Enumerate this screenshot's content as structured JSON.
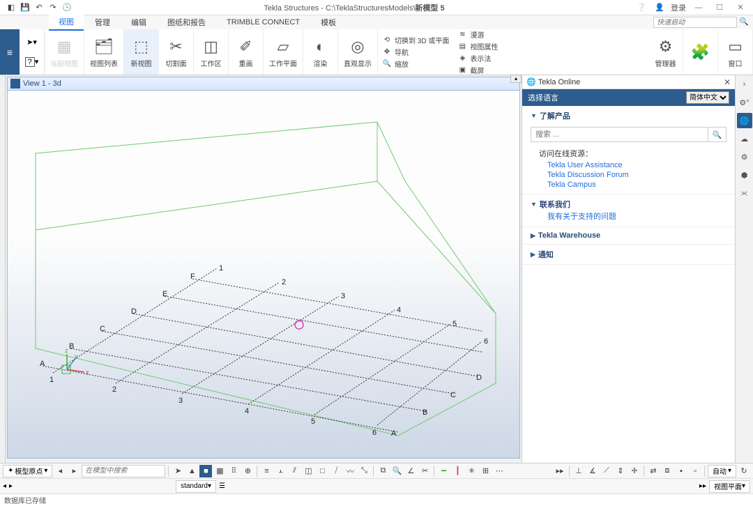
{
  "title": {
    "app": "Tekla Structures",
    "path": "C:\\TeklaStructuresModels\\",
    "model": "新模型 5"
  },
  "titlebar": {
    "login": "登录"
  },
  "menubar": {
    "tabs": [
      "视图",
      "管理",
      "编辑",
      "图纸和报告",
      "TRIMBLE CONNECT",
      "模板"
    ],
    "active": 0,
    "quick_placeholder": "快速启动"
  },
  "ribbon": {
    "groups": [
      {
        "label": "当前视图",
        "disabled": true
      },
      {
        "label": "视图列表"
      },
      {
        "label": "新视图",
        "active": true
      },
      {
        "label": "切割面"
      },
      {
        "label": "工作区"
      },
      {
        "label": "重画"
      },
      {
        "label": "工作平面"
      },
      {
        "label": "渲染"
      },
      {
        "label": "直观显示"
      }
    ],
    "sub3d": {
      "a": "切换到 3D 或平面",
      "b": "导航",
      "c": "缩放"
    },
    "subview": {
      "a": "漫游",
      "b": "视图属性",
      "c": "表示法",
      "d": "截屏"
    },
    "right": [
      {
        "label": "管理器"
      },
      {
        "label": ""
      },
      {
        "label": "窗口"
      }
    ]
  },
  "view": {
    "header": "View 1 - 3d",
    "labels_near": {
      "A": "A",
      "B": "B",
      "C": "C",
      "D": "D",
      "E": "E",
      "F": "F",
      "1": "1",
      "2": "2",
      "3": "3",
      "4": "4",
      "5": "5",
      "6": "6"
    },
    "axes": {
      "x": "x",
      "y": "y",
      "z": "z"
    }
  },
  "online": {
    "title": "Tekla Online",
    "langlabel": "选择语言",
    "lang": "简体中文",
    "sections": {
      "learn": {
        "title": "了解产品",
        "search_ph": "搜索 ...",
        "resources_label": "访问在线资源：",
        "links": [
          "Tekla User Assistance",
          "Tekla Discussion Forum",
          "Tekla Campus"
        ]
      },
      "contact": {
        "title": "联系我们",
        "link": "我有关于支持的问题"
      },
      "warehouse": {
        "title": "Tekla Warehouse"
      },
      "notify": {
        "title": "通知"
      }
    }
  },
  "bottombar": {
    "origin": "模型原点",
    "search_ph": "在模型中搜索",
    "standard": "standard",
    "viewplane": "视图平面",
    "auto": "自动"
  },
  "status": "数据库已存储"
}
